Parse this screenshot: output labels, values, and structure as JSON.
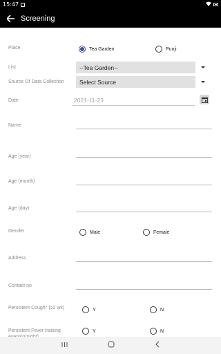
{
  "status_bar": {
    "time": "15:47"
  },
  "app_bar": {
    "title": "Screening"
  },
  "form": {
    "place": {
      "label": "Place",
      "options": [
        "Tea Garden",
        "Punji"
      ],
      "selected": "Tea Garden"
    },
    "list": {
      "label": "List",
      "value": "--Tea Garden--"
    },
    "source": {
      "label": "Source Of Data Collection",
      "value": "Select Source"
    },
    "date": {
      "label": "Date",
      "value": "2021-11-23"
    },
    "name": {
      "label": "Name"
    },
    "age_year": {
      "label": "Age (year)"
    },
    "age_month": {
      "label": "Age (month)"
    },
    "age_day": {
      "label": "Age (day)"
    },
    "gender": {
      "label": "Gender",
      "options": [
        "Male",
        "Female"
      ]
    },
    "address": {
      "label": "Address"
    },
    "contact": {
      "label": "Contact no"
    },
    "cough": {
      "label": "Persistent Cough* (≥2 wk)",
      "options": [
        "Y",
        "N"
      ]
    },
    "fever": {
      "label": "Persistent Fever (raising evening/night)",
      "options": [
        "Y",
        "N"
      ]
    }
  },
  "icons": {
    "back": "arrow-left-icon",
    "calendar": "calendar-icon",
    "recents": "recents-icon",
    "home": "home-icon",
    "nav_back": "nav-back-icon"
  }
}
